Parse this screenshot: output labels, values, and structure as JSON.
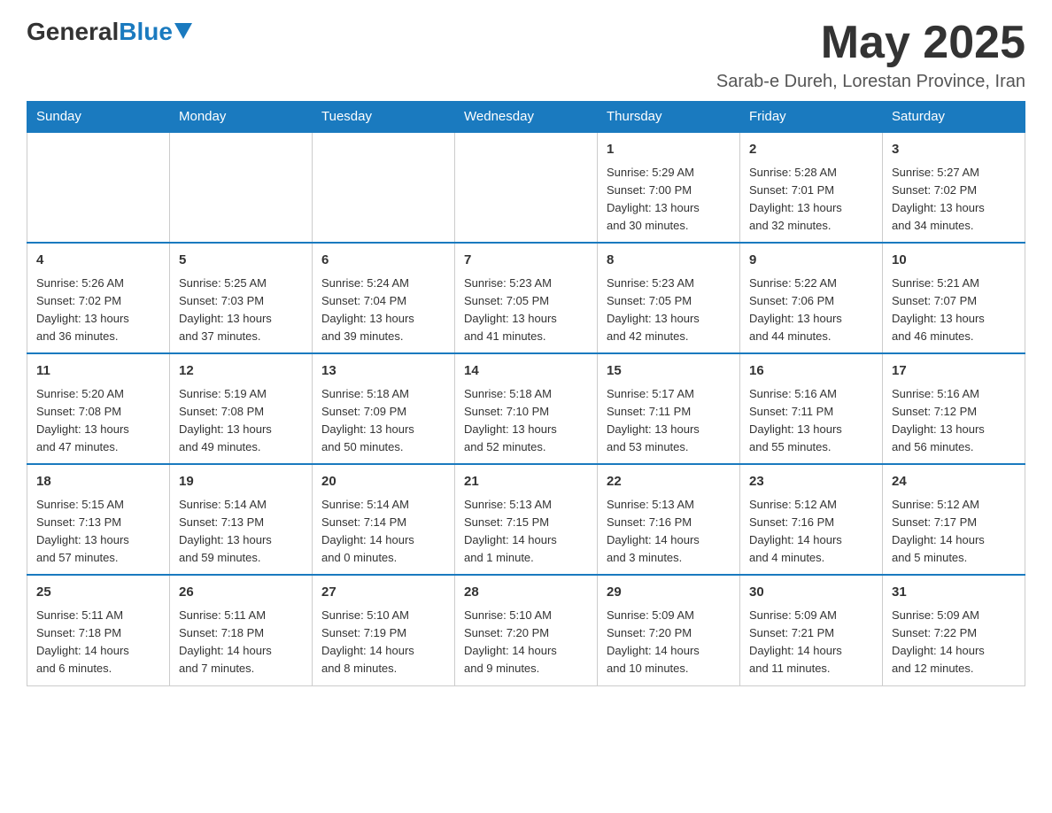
{
  "header": {
    "logo_general": "General",
    "logo_blue": "Blue",
    "month_title": "May 2025",
    "location": "Sarab-e Dureh, Lorestan Province, Iran"
  },
  "weekdays": [
    "Sunday",
    "Monday",
    "Tuesday",
    "Wednesday",
    "Thursday",
    "Friday",
    "Saturday"
  ],
  "weeks": [
    [
      {
        "day": "",
        "info": ""
      },
      {
        "day": "",
        "info": ""
      },
      {
        "day": "",
        "info": ""
      },
      {
        "day": "",
        "info": ""
      },
      {
        "day": "1",
        "info": "Sunrise: 5:29 AM\nSunset: 7:00 PM\nDaylight: 13 hours\nand 30 minutes."
      },
      {
        "day": "2",
        "info": "Sunrise: 5:28 AM\nSunset: 7:01 PM\nDaylight: 13 hours\nand 32 minutes."
      },
      {
        "day": "3",
        "info": "Sunrise: 5:27 AM\nSunset: 7:02 PM\nDaylight: 13 hours\nand 34 minutes."
      }
    ],
    [
      {
        "day": "4",
        "info": "Sunrise: 5:26 AM\nSunset: 7:02 PM\nDaylight: 13 hours\nand 36 minutes."
      },
      {
        "day": "5",
        "info": "Sunrise: 5:25 AM\nSunset: 7:03 PM\nDaylight: 13 hours\nand 37 minutes."
      },
      {
        "day": "6",
        "info": "Sunrise: 5:24 AM\nSunset: 7:04 PM\nDaylight: 13 hours\nand 39 minutes."
      },
      {
        "day": "7",
        "info": "Sunrise: 5:23 AM\nSunset: 7:05 PM\nDaylight: 13 hours\nand 41 minutes."
      },
      {
        "day": "8",
        "info": "Sunrise: 5:23 AM\nSunset: 7:05 PM\nDaylight: 13 hours\nand 42 minutes."
      },
      {
        "day": "9",
        "info": "Sunrise: 5:22 AM\nSunset: 7:06 PM\nDaylight: 13 hours\nand 44 minutes."
      },
      {
        "day": "10",
        "info": "Sunrise: 5:21 AM\nSunset: 7:07 PM\nDaylight: 13 hours\nand 46 minutes."
      }
    ],
    [
      {
        "day": "11",
        "info": "Sunrise: 5:20 AM\nSunset: 7:08 PM\nDaylight: 13 hours\nand 47 minutes."
      },
      {
        "day": "12",
        "info": "Sunrise: 5:19 AM\nSunset: 7:08 PM\nDaylight: 13 hours\nand 49 minutes."
      },
      {
        "day": "13",
        "info": "Sunrise: 5:18 AM\nSunset: 7:09 PM\nDaylight: 13 hours\nand 50 minutes."
      },
      {
        "day": "14",
        "info": "Sunrise: 5:18 AM\nSunset: 7:10 PM\nDaylight: 13 hours\nand 52 minutes."
      },
      {
        "day": "15",
        "info": "Sunrise: 5:17 AM\nSunset: 7:11 PM\nDaylight: 13 hours\nand 53 minutes."
      },
      {
        "day": "16",
        "info": "Sunrise: 5:16 AM\nSunset: 7:11 PM\nDaylight: 13 hours\nand 55 minutes."
      },
      {
        "day": "17",
        "info": "Sunrise: 5:16 AM\nSunset: 7:12 PM\nDaylight: 13 hours\nand 56 minutes."
      }
    ],
    [
      {
        "day": "18",
        "info": "Sunrise: 5:15 AM\nSunset: 7:13 PM\nDaylight: 13 hours\nand 57 minutes."
      },
      {
        "day": "19",
        "info": "Sunrise: 5:14 AM\nSunset: 7:13 PM\nDaylight: 13 hours\nand 59 minutes."
      },
      {
        "day": "20",
        "info": "Sunrise: 5:14 AM\nSunset: 7:14 PM\nDaylight: 14 hours\nand 0 minutes."
      },
      {
        "day": "21",
        "info": "Sunrise: 5:13 AM\nSunset: 7:15 PM\nDaylight: 14 hours\nand 1 minute."
      },
      {
        "day": "22",
        "info": "Sunrise: 5:13 AM\nSunset: 7:16 PM\nDaylight: 14 hours\nand 3 minutes."
      },
      {
        "day": "23",
        "info": "Sunrise: 5:12 AM\nSunset: 7:16 PM\nDaylight: 14 hours\nand 4 minutes."
      },
      {
        "day": "24",
        "info": "Sunrise: 5:12 AM\nSunset: 7:17 PM\nDaylight: 14 hours\nand 5 minutes."
      }
    ],
    [
      {
        "day": "25",
        "info": "Sunrise: 5:11 AM\nSunset: 7:18 PM\nDaylight: 14 hours\nand 6 minutes."
      },
      {
        "day": "26",
        "info": "Sunrise: 5:11 AM\nSunset: 7:18 PM\nDaylight: 14 hours\nand 7 minutes."
      },
      {
        "day": "27",
        "info": "Sunrise: 5:10 AM\nSunset: 7:19 PM\nDaylight: 14 hours\nand 8 minutes."
      },
      {
        "day": "28",
        "info": "Sunrise: 5:10 AM\nSunset: 7:20 PM\nDaylight: 14 hours\nand 9 minutes."
      },
      {
        "day": "29",
        "info": "Sunrise: 5:09 AM\nSunset: 7:20 PM\nDaylight: 14 hours\nand 10 minutes."
      },
      {
        "day": "30",
        "info": "Sunrise: 5:09 AM\nSunset: 7:21 PM\nDaylight: 14 hours\nand 11 minutes."
      },
      {
        "day": "31",
        "info": "Sunrise: 5:09 AM\nSunset: 7:22 PM\nDaylight: 14 hours\nand 12 minutes."
      }
    ]
  ]
}
